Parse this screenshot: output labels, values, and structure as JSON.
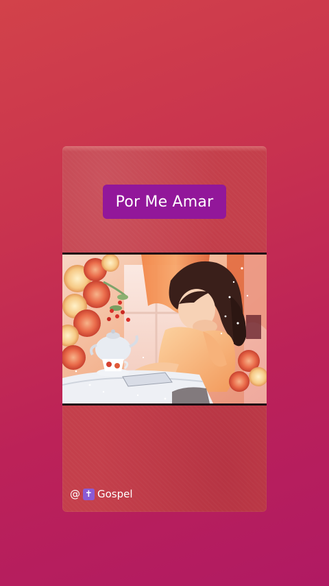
{
  "story": {
    "title": "Por Me Amar",
    "handle_prefix": "@",
    "handle_icon": "latin-cross-icon",
    "handle_text": "Gospel",
    "image_description_icon": "woman-reading-tea-flowers-painting"
  },
  "colors": {
    "background_top": "#d2424a",
    "background_bottom": "#b01a63",
    "card": "#c43f4b",
    "title_badge": "#92179a",
    "title_text": "#ffffff",
    "cross_badge": "#8a5bd6"
  }
}
